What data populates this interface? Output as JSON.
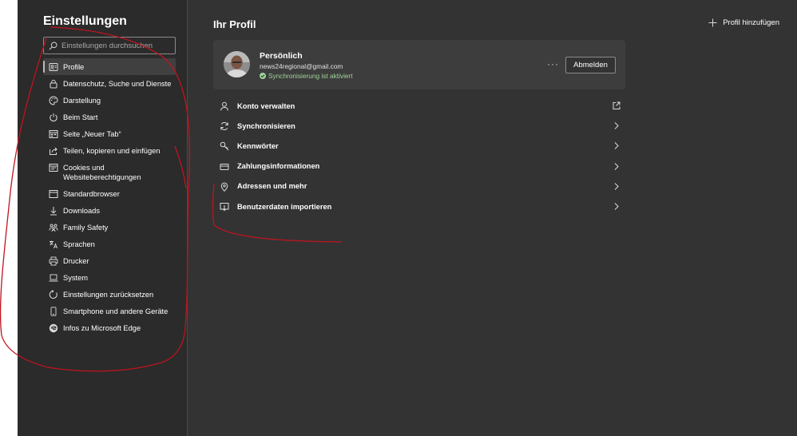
{
  "sidebar": {
    "title": "Einstellungen",
    "search_placeholder": "Einstellungen durchsuchen",
    "items": [
      {
        "label": "Profile",
        "icon": "profile-card-icon",
        "active": true
      },
      {
        "label": "Datenschutz, Suche und Dienste",
        "icon": "lock-icon"
      },
      {
        "label": "Darstellung",
        "icon": "palette-icon"
      },
      {
        "label": "Beim Start",
        "icon": "power-icon"
      },
      {
        "label": "Seite „Neuer Tab“",
        "icon": "new-tab-page-icon"
      },
      {
        "label": "Teilen, kopieren und einfügen",
        "icon": "share-icon"
      },
      {
        "label": "Cookies und Websiteberechtigungen",
        "icon": "cookies-icon"
      },
      {
        "label": "Standardbrowser",
        "icon": "default-browser-icon"
      },
      {
        "label": "Downloads",
        "icon": "download-icon"
      },
      {
        "label": "Family Safety",
        "icon": "family-icon"
      },
      {
        "label": "Sprachen",
        "icon": "languages-icon"
      },
      {
        "label": "Drucker",
        "icon": "printer-icon"
      },
      {
        "label": "System",
        "icon": "laptop-icon"
      },
      {
        "label": "Einstellungen zurücksetzen",
        "icon": "reset-icon"
      },
      {
        "label": "Smartphone und andere Geräte",
        "icon": "phone-icon"
      },
      {
        "label": "Infos zu Microsoft Edge",
        "icon": "edge-logo-icon"
      }
    ]
  },
  "main": {
    "title": "Ihr Profil",
    "add_profile_label": "Profil hinzufügen",
    "profile": {
      "name": "Persönlich",
      "email": "news24regional@gmail.com",
      "sync_status": "Synchronisierung ist aktiviert",
      "more_label": "···",
      "signout_label": "Abmelden"
    },
    "rows": [
      {
        "label": "Konto verwalten",
        "icon": "person-icon",
        "trail": "external-link-icon"
      },
      {
        "label": "Synchronisieren",
        "icon": "sync-icon",
        "trail": "chevron-right-icon"
      },
      {
        "label": "Kennwörter",
        "icon": "key-icon",
        "trail": "chevron-right-icon"
      },
      {
        "label": "Zahlungsinformationen",
        "icon": "credit-card-icon",
        "trail": "chevron-right-icon"
      },
      {
        "label": "Adressen und mehr",
        "icon": "location-pin-icon",
        "trail": "chevron-right-icon"
      },
      {
        "label": "Benutzerdaten importieren",
        "icon": "import-icon",
        "trail": "chevron-right-icon"
      }
    ]
  },
  "colors": {
    "sidebar_bg": "#2b2b2b",
    "main_bg": "#333333",
    "card_bg": "#3d3d3d",
    "sync_green": "#9ed39a",
    "annotation_red": "#c0141e"
  }
}
